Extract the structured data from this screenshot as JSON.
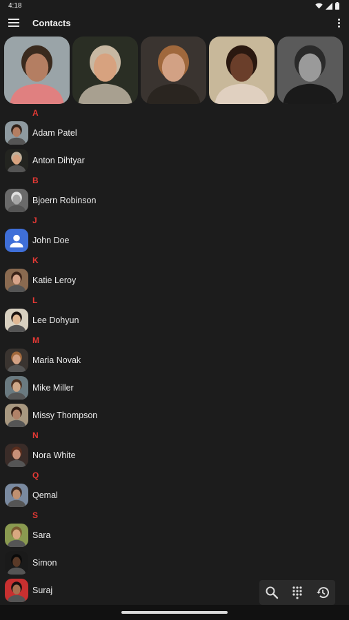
{
  "status_bar": {
    "time": "4:18"
  },
  "app_bar": {
    "title": "Contacts",
    "menu_icon": "hamburger-menu-icon",
    "overflow_icon": "overflow-menu-icon"
  },
  "favorites": [
    {
      "id": "fav-1",
      "bg": "#9aa4a8",
      "skin": "#b47e62",
      "hair": "#3a2a1e",
      "shirt": "#e08080"
    },
    {
      "id": "fav-2",
      "bg": "#2a2e24",
      "skin": "#d7a27f",
      "hair": "#c8b8a2",
      "shirt": "#a8a090"
    },
    {
      "id": "fav-3",
      "bg": "#3a3430",
      "skin": "#d2a184",
      "hair": "#a0683c",
      "shirt": "#2a2520"
    },
    {
      "id": "fav-4",
      "bg": "#c8b89a",
      "skin": "#6a3e2a",
      "hair": "#2a1810",
      "shirt": "#e0d0c0"
    },
    {
      "id": "fav-5",
      "bg": "#5a5a5a",
      "skin": "#9a9a9a",
      "hair": "#2a2a2a",
      "shirt": "#1a1a1a"
    }
  ],
  "contacts": [
    {
      "letter": "A",
      "name": "Adam Patel",
      "bg": "#8e9aa0",
      "skin": "#b47e62",
      "hair": "#2e2018"
    },
    {
      "letter": "",
      "name": "Anton Dihtyar",
      "bg": "#232420",
      "skin": "#d7a27f",
      "hair": "#c0b09a"
    },
    {
      "letter": "B",
      "name": "Bjoern Robinson",
      "bg": "#6a6a6a",
      "skin": "#a5a5a5",
      "hair": "#e0e0e0"
    },
    {
      "letter": "J",
      "name": "John Doe",
      "bg": "#3f6fd8",
      "skin": "",
      "hair": "",
      "default": true
    },
    {
      "letter": "K",
      "name": "Katie Leroy",
      "bg": "#8a6a50",
      "skin": "#d6a48a",
      "hair": "#3a2218"
    },
    {
      "letter": "L",
      "name": "Lee Dohyun",
      "bg": "#d8d0c0",
      "skin": "#e0b894",
      "hair": "#1a1210"
    },
    {
      "letter": "M",
      "name": "Maria Novak",
      "bg": "#3a3430",
      "skin": "#d2a184",
      "hair": "#a0683c"
    },
    {
      "letter": "",
      "name": "Mike Miller",
      "bg": "#6a7a80",
      "skin": "#d0a888",
      "hair": "#4a3020"
    },
    {
      "letter": "",
      "name": "Missy Thompson",
      "bg": "#a89880",
      "skin": "#b08268",
      "hair": "#2a1810"
    },
    {
      "letter": "N",
      "name": "Nora White",
      "bg": "#3a2c28",
      "skin": "#c89078",
      "hair": "#5a2e1e"
    },
    {
      "letter": "Q",
      "name": "Qemal",
      "bg": "#7a8aa0",
      "skin": "#c09070",
      "hair": "#3a2820"
    },
    {
      "letter": "S",
      "name": "Sara",
      "bg": "#8a9a50",
      "skin": "#d8a880",
      "hair": "#7a5a30"
    },
    {
      "letter": "",
      "name": "Simon",
      "bg": "#1a1a1a",
      "skin": "#5a3a28",
      "hair": "#0a0a0a"
    },
    {
      "letter": "",
      "name": "Suraj",
      "bg": "#c83030",
      "skin": "#a87050",
      "hair": "#1a1010"
    }
  ],
  "bottom_actions": [
    {
      "name": "search-icon"
    },
    {
      "name": "dialpad-icon"
    },
    {
      "name": "history-icon"
    }
  ],
  "colors": {
    "background": "#1c1c1c",
    "accent": "#e53935",
    "text": "#ececec"
  }
}
